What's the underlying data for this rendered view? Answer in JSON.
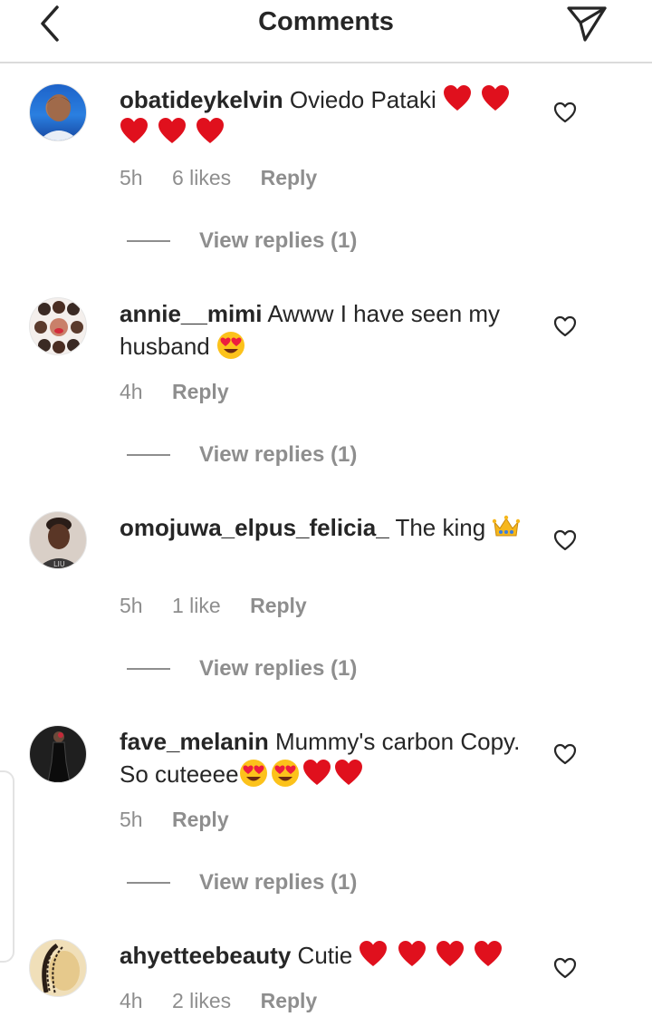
{
  "header": {
    "title": "Comments",
    "back_icon": "chevron-left-icon",
    "share_icon": "paper-plane-icon"
  },
  "colors": {
    "text": "#262626",
    "muted": "#8e8e8e",
    "heart_red": "#e0101d",
    "divider": "#dbdbdb"
  },
  "comments": [
    {
      "username": "obatideykelvin",
      "text": "Oviedo Pataki",
      "emojis": [
        "red-heart",
        "red-heart",
        "red-heart",
        "red-heart",
        "red-heart"
      ],
      "time": "5h",
      "likes": "6 likes",
      "reply": "Reply",
      "view_replies": "View replies (1)"
    },
    {
      "username": "annie__mimi",
      "text": "Awww I have seen my husband",
      "emojis": [
        "heart-eyes"
      ],
      "time": "4h",
      "likes": "",
      "reply": "Reply",
      "view_replies": "View replies (1)"
    },
    {
      "username": "omojuwa_elpus_felicia_",
      "text": "The king",
      "emojis": [
        "crown"
      ],
      "time": "5h",
      "likes": "1 like",
      "reply": "Reply",
      "view_replies": "View replies (1)"
    },
    {
      "username": "fave_melanin",
      "text": "Mummy's carbon Copy. So cuteeee",
      "emojis": [
        "heart-eyes",
        "heart-eyes",
        "red-heart",
        "red-heart"
      ],
      "time": "5h",
      "likes": "",
      "reply": "Reply",
      "view_replies": "View replies (1)"
    },
    {
      "username": "ahyetteebeauty",
      "text": "Cutie",
      "emojis": [
        "red-heart",
        "red-heart",
        "red-heart",
        "red-heart"
      ],
      "time": "4h",
      "likes": "2 likes",
      "reply": "Reply",
      "view_replies": ""
    }
  ]
}
